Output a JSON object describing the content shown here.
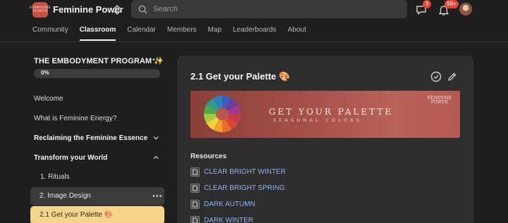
{
  "header": {
    "logo_text": [
      "FEMININE",
      "POWER"
    ],
    "brand": "Feminine Power",
    "search_placeholder": "Search",
    "chat_badge": "3",
    "notif_badge": "99+"
  },
  "nav": {
    "tabs": [
      "Community",
      "Classroom",
      "Calendar",
      "Members",
      "Map",
      "Leaderboards",
      "About"
    ],
    "active": "Classroom"
  },
  "sidebar": {
    "course_title": "THE EMBODYMENT PROGRAM ✨",
    "progress_label": "0%",
    "progress_value": 0,
    "items": [
      {
        "label": "Welcome"
      },
      {
        "label": "What is Feminine Energy?"
      },
      {
        "label": "Reclaiming the Feminine Essence"
      },
      {
        "label": "Transform your World"
      },
      {
        "label": "1. Rituals"
      },
      {
        "label": "2. Image Design"
      },
      {
        "label": "2.1 Get your Palette 🎨"
      }
    ]
  },
  "lesson": {
    "title": "2.1 Get your Palette 🎨",
    "banner_title": "GET YOUR PALETTE",
    "banner_subtitle": "SEASONAL COLORS",
    "banner_mark": [
      "FEMININE",
      "POWER"
    ],
    "resources_label": "Resources",
    "resources": [
      "CLEAR BRIGHT WINTER",
      "CLEAR BRIGHT SPRING",
      "DARK AUTUMN",
      "DARK WINTER"
    ]
  },
  "colors": {
    "accent_active": "#f4d58a",
    "link": "#8fb1ee",
    "badge": "#e2443a"
  }
}
